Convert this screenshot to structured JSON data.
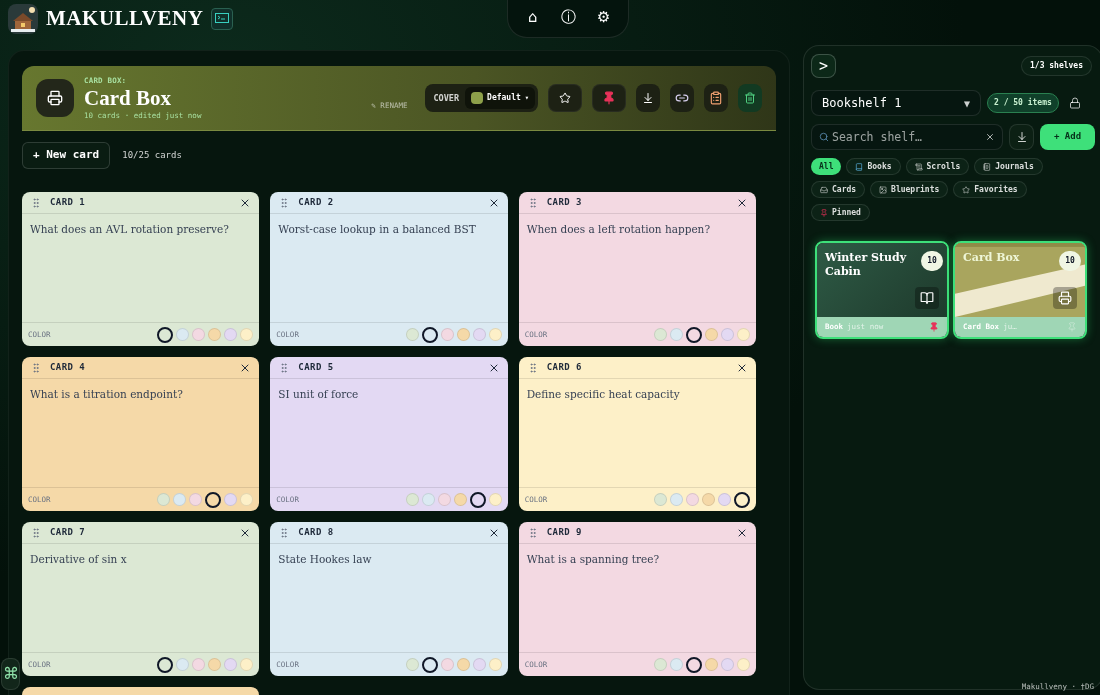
{
  "app": {
    "title": "MAKULLVENY"
  },
  "nav": {
    "buttons": [
      "⌂",
      "ⓘ",
      "⚙"
    ]
  },
  "box": {
    "eyebrow": "CARD BOX:",
    "title": "Card Box",
    "meta": "10 cards · edited just now",
    "rename": "✎ RENAME",
    "cover_label": "COVER",
    "cover_value": "Default",
    "cover_caret": "▾",
    "favorite": false,
    "pinned": true
  },
  "toolbar": {
    "new_card": "+ New card",
    "count": "10/25 cards"
  },
  "cards": [
    {
      "title": "CARD 1",
      "text": "What does an AVL rotation preserve?",
      "color_label": "COLOR",
      "swatches": [
        {
          "color": "#dce8d4",
          "selected": true
        },
        {
          "color": "#dbeaf2",
          "selected": false
        },
        {
          "color": "#f3d9e2",
          "selected": false
        },
        {
          "color": "#f5d9a8",
          "selected": false
        },
        {
          "color": "#e3d9f3",
          "selected": false
        },
        {
          "color": "#fdf0c8",
          "selected": false
        }
      ]
    },
    {
      "title": "CARD 2",
      "text": "Worst-case lookup in a balanced BST",
      "color_label": "COLOR",
      "swatches": [
        {
          "color": "#dce8d4",
          "selected": false
        },
        {
          "color": "#dbeaf2",
          "selected": true
        },
        {
          "color": "#f3d9e2",
          "selected": false
        },
        {
          "color": "#f5d9a8",
          "selected": false
        },
        {
          "color": "#e3d9f3",
          "selected": false
        },
        {
          "color": "#fdf0c8",
          "selected": false
        }
      ]
    },
    {
      "title": "CARD 3",
      "text": "When does a left rotation happen?",
      "color_label": "COLOR",
      "swatches": [
        {
          "color": "#dce8d4",
          "selected": false
        },
        {
          "color": "#dbeaf2",
          "selected": false
        },
        {
          "color": "#f3d9e2",
          "selected": true
        },
        {
          "color": "#f5d9a8",
          "selected": false
        },
        {
          "color": "#e3d9f3",
          "selected": false
        },
        {
          "color": "#fdf0c8",
          "selected": false
        }
      ]
    },
    {
      "title": "CARD 4",
      "text": "What is a titration endpoint?",
      "color_label": "COLOR",
      "swatches": [
        {
          "color": "#dce8d4",
          "selected": false
        },
        {
          "color": "#dbeaf2",
          "selected": false
        },
        {
          "color": "#f3d9e2",
          "selected": false
        },
        {
          "color": "#f5d9a8",
          "selected": true
        },
        {
          "color": "#e3d9f3",
          "selected": false
        },
        {
          "color": "#fdf0c8",
          "selected": false
        }
      ]
    },
    {
      "title": "CARD 5",
      "text": "SI unit of force",
      "color_label": "COLOR",
      "swatches": [
        {
          "color": "#dce8d4",
          "selected": false
        },
        {
          "color": "#dbeaf2",
          "selected": false
        },
        {
          "color": "#f3d9e2",
          "selected": false
        },
        {
          "color": "#f5d9a8",
          "selected": false
        },
        {
          "color": "#e3d9f3",
          "selected": true
        },
        {
          "color": "#fdf0c8",
          "selected": false
        }
      ]
    },
    {
      "title": "CARD 6",
      "text": "Define specific heat capacity",
      "color_label": "COLOR",
      "swatches": [
        {
          "color": "#dce8d4",
          "selected": false
        },
        {
          "color": "#dbeaf2",
          "selected": false
        },
        {
          "color": "#f3d9e2",
          "selected": false
        },
        {
          "color": "#f5d9a8",
          "selected": false
        },
        {
          "color": "#e3d9f3",
          "selected": false
        },
        {
          "color": "#fdf0c8",
          "selected": true
        }
      ]
    },
    {
      "title": "CARD 7",
      "text": "Derivative of sin x",
      "color_label": "COLOR",
      "swatches": [
        {
          "color": "#dce8d4",
          "selected": true
        },
        {
          "color": "#dbeaf2",
          "selected": false
        },
        {
          "color": "#f3d9e2",
          "selected": false
        },
        {
          "color": "#f5d9a8",
          "selected": false
        },
        {
          "color": "#e3d9f3",
          "selected": false
        },
        {
          "color": "#fdf0c8",
          "selected": false
        }
      ]
    },
    {
      "title": "CARD 8",
      "text": "State Hookes law",
      "color_label": "COLOR",
      "swatches": [
        {
          "color": "#dce8d4",
          "selected": false
        },
        {
          "color": "#dbeaf2",
          "selected": true
        },
        {
          "color": "#f3d9e2",
          "selected": false
        },
        {
          "color": "#f5d9a8",
          "selected": false
        },
        {
          "color": "#e3d9f3",
          "selected": false
        },
        {
          "color": "#fdf0c8",
          "selected": false
        }
      ]
    },
    {
      "title": "CARD 9",
      "text": "What is a spanning tree?",
      "color_label": "COLOR",
      "swatches": [
        {
          "color": "#dce8d4",
          "selected": false
        },
        {
          "color": "#dbeaf2",
          "selected": false
        },
        {
          "color": "#f3d9e2",
          "selected": true
        },
        {
          "color": "#f5d9a8",
          "selected": false
        },
        {
          "color": "#e3d9f3",
          "selected": false
        },
        {
          "color": "#fdf0c8",
          "selected": false
        }
      ]
    }
  ],
  "shortcut": "⌘",
  "sidebar": {
    "toggle": ">",
    "shelves": "1/3 shelves",
    "shelf": "Bookshelf 1",
    "shelf_caret": "▼",
    "items": "2 / 50 items",
    "search_placeholder": "Search shelf…",
    "add": "+ Add",
    "filters": [
      {
        "label": "All",
        "kind": "all",
        "selected": true
      },
      {
        "label": "Books",
        "kind": "book",
        "selected": false
      },
      {
        "label": "Scrolls",
        "kind": "scroll",
        "selected": false
      },
      {
        "label": "Journals",
        "kind": "journal",
        "selected": false
      },
      {
        "label": "Cards",
        "kind": "cards",
        "selected": false
      },
      {
        "label": "Blueprints",
        "kind": "blueprint",
        "selected": false
      },
      {
        "label": "Favorites",
        "kind": "star",
        "selected": false
      },
      {
        "label": "Pinned",
        "kind": "pin",
        "selected": false
      }
    ],
    "shelf_items": [
      {
        "title": "Winter Study Cabin",
        "count": "10",
        "type": "Book",
        "time": "just now",
        "kind": "book",
        "pinned": true
      },
      {
        "title": "Card Box",
        "count": "10",
        "type": "Card Box",
        "time": "ju…",
        "kind": "cardbox",
        "pinned": false
      }
    ]
  },
  "footer": "Makullveny · †DG"
}
